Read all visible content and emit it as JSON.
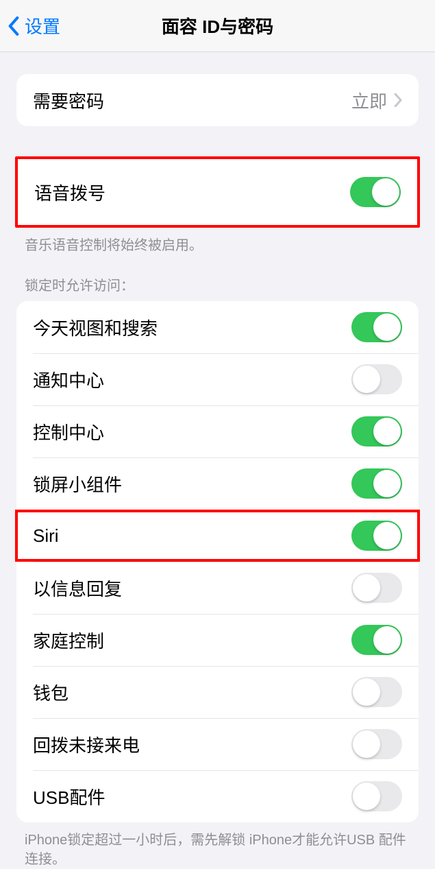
{
  "navbar": {
    "back_label": "设置",
    "title": "面容 ID与密码"
  },
  "require_passcode": {
    "label": "需要密码",
    "value": "立即"
  },
  "voice_dial": {
    "label": "语音拨号",
    "footer": "音乐语音控制将始终被启用。"
  },
  "lock_access": {
    "header": "锁定时允许访问：",
    "items": [
      {
        "label": "今天视图和搜索",
        "on": true
      },
      {
        "label": "通知中心",
        "on": false
      },
      {
        "label": "控制中心",
        "on": true
      },
      {
        "label": "锁屏小组件",
        "on": true
      },
      {
        "label": "Siri",
        "on": true
      },
      {
        "label": "以信息回复",
        "on": false
      },
      {
        "label": "家庭控制",
        "on": true
      },
      {
        "label": "钱包",
        "on": false
      },
      {
        "label": "回拨未接来电",
        "on": false
      },
      {
        "label": "USB配件",
        "on": false
      }
    ],
    "footer": "iPhone锁定超过一小时后，需先解锁 iPhone才能允许USB 配件连接。"
  }
}
